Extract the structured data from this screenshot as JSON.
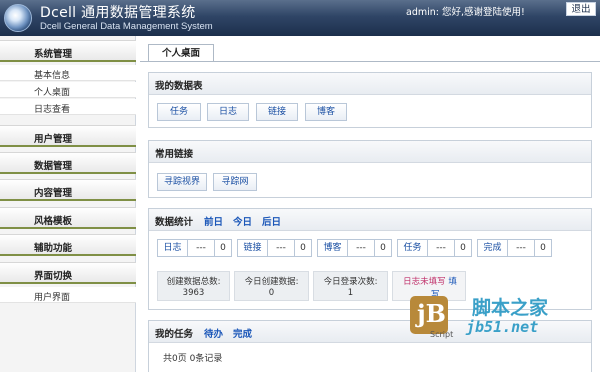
{
  "header": {
    "title": "Dcell 通用数据管理系统",
    "subtitle": "Dcell General Data Management System",
    "welcome": "admin: 您好,感谢登陆使用!",
    "logout": "退出"
  },
  "sidebar": {
    "groups": [
      {
        "label": "系统管理",
        "items": [
          "基本信息",
          "个人桌面",
          "日志查看"
        ]
      },
      {
        "label": "用户管理"
      },
      {
        "label": "数据管理"
      },
      {
        "label": "内容管理"
      },
      {
        "label": "风格模板"
      },
      {
        "label": "辅助功能"
      },
      {
        "label": "界面切换",
        "items": [
          "用户界面"
        ]
      }
    ]
  },
  "main": {
    "tab": "个人桌面",
    "my_data": {
      "title": "我的数据表",
      "buttons": [
        "任务",
        "日志",
        "链接",
        "博客"
      ]
    },
    "links": {
      "title": "常用链接",
      "buttons": [
        "寻踪视界",
        "寻踪网"
      ]
    },
    "stats": {
      "title": "数据统计",
      "links": [
        "前日",
        "今日",
        "后日"
      ],
      "boxes": [
        {
          "label": "日志",
          "mid": "---",
          "num": "0"
        },
        {
          "label": "链接",
          "mid": "---",
          "num": "0"
        },
        {
          "label": "博客",
          "mid": "---",
          "num": "0"
        },
        {
          "label": "任务",
          "mid": "---",
          "num": "0"
        },
        {
          "label": "完成",
          "mid": "---",
          "num": "0"
        }
      ],
      "info": [
        {
          "l1": "创建数据总数:",
          "l2": "3963"
        },
        {
          "l1": "今日创建数据:",
          "l2": "0"
        },
        {
          "l1": "今日登录次数:",
          "l2": "1"
        },
        {
          "l1": "日志未填写",
          "l1b": "填",
          "l2": "写"
        }
      ]
    },
    "tasks": {
      "title": "我的任务",
      "links": [
        "待办",
        "完成"
      ],
      "records": "共0页 0条记录"
    }
  },
  "watermark": {
    "logo": "jB",
    "cn": "脚本之家",
    "en": "jb51.net",
    "script": "Script"
  },
  "colors": {
    "header_dark": "#1c2f4c",
    "link_blue": "#1a56b8",
    "menu_underline": "#7f8f45",
    "alert_red": "#c0306a"
  }
}
